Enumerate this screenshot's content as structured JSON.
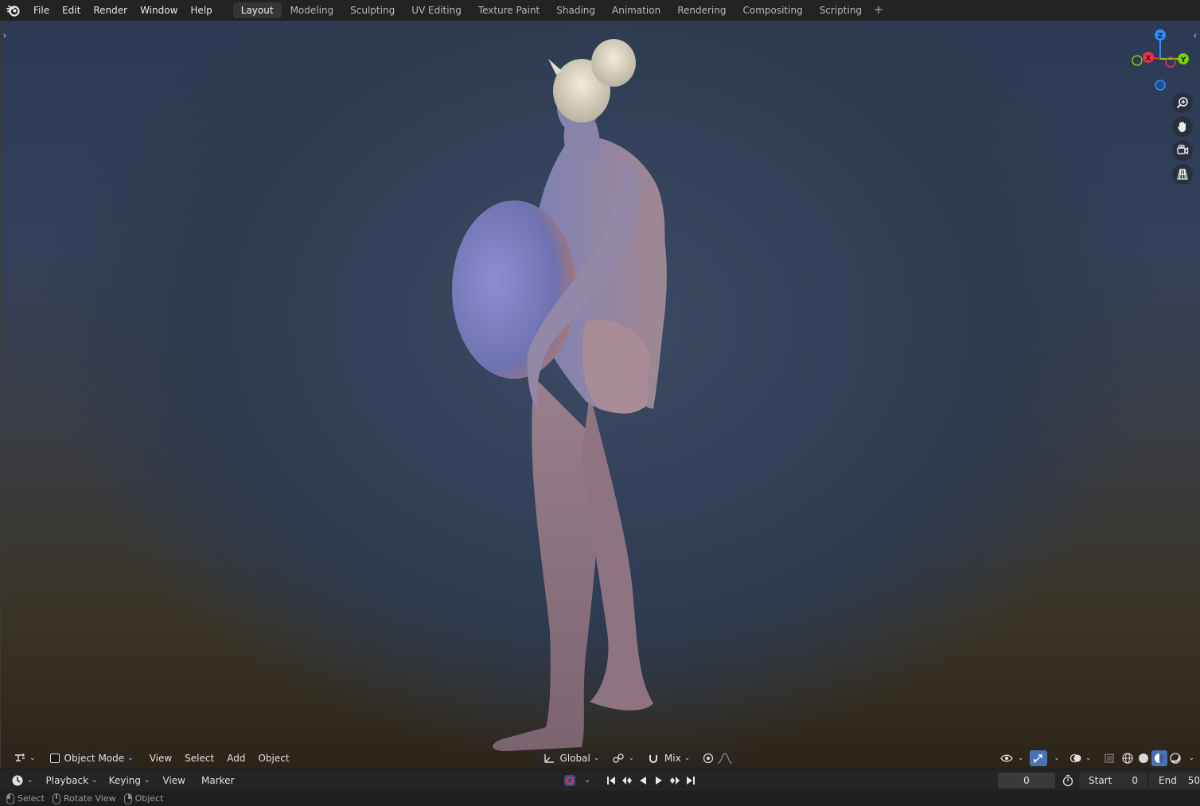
{
  "menu": [
    "File",
    "Edit",
    "Render",
    "Window",
    "Help"
  ],
  "workspaces": [
    "Layout",
    "Modeling",
    "Sculpting",
    "UV Editing",
    "Texture Paint",
    "Shading",
    "Animation",
    "Rendering",
    "Compositing",
    "Scripting"
  ],
  "workspace_active": "Layout",
  "workspace_add": "+",
  "viewport_header": {
    "mode": "Object Mode",
    "menus": [
      "View",
      "Select",
      "Add",
      "Object"
    ],
    "transform_orientation": "Global",
    "snap_mode": "Mix"
  },
  "gizmo": {
    "z": "Z",
    "y": "Y",
    "x": "X"
  },
  "timeline": {
    "menus": [
      "Playback",
      "Keying",
      "View",
      "Marker"
    ],
    "current_frame": "0",
    "start_label": "Start",
    "start_value": "0",
    "end_label": "End",
    "end_value": "50"
  },
  "status": {
    "select": "Select",
    "rotate": "Rotate View",
    "object": "Object"
  },
  "colors": {
    "axis_x": "#e8334a",
    "axis_y": "#7ad100",
    "axis_z": "#2c8fff",
    "accent": "#4772b3"
  }
}
